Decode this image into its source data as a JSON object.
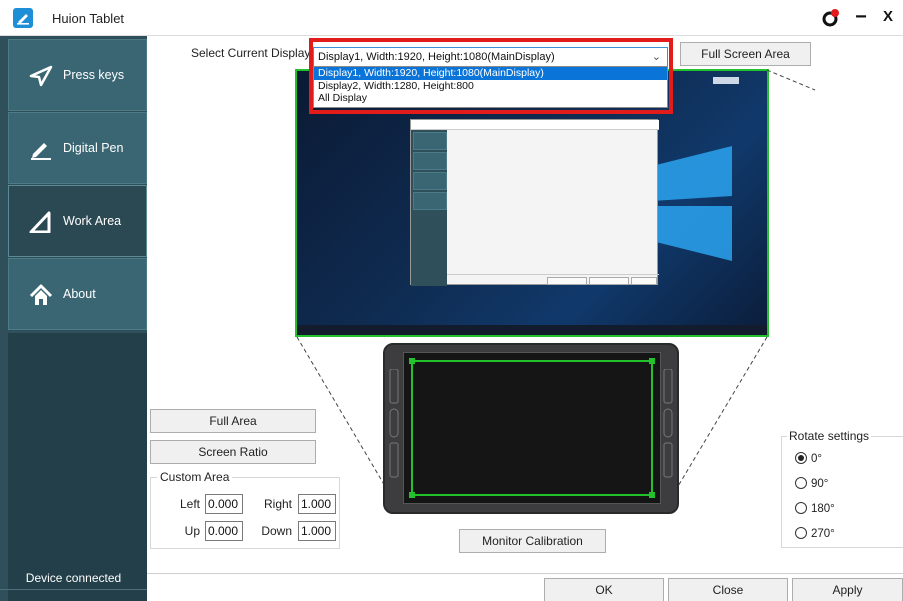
{
  "window": {
    "title": "Huion Tablet",
    "controls": {
      "minimize": "−",
      "close": "X"
    }
  },
  "sidebar": {
    "items": [
      {
        "label": "Press keys",
        "icon": "send-arrow-icon",
        "active": false
      },
      {
        "label": "Digital Pen",
        "icon": "pen-icon",
        "active": false
      },
      {
        "label": "Work Area",
        "icon": "work-area-icon",
        "active": true
      },
      {
        "label": "About",
        "icon": "home-icon",
        "active": false
      }
    ],
    "status": "Device connected"
  },
  "display": {
    "label": "Select Current Display",
    "selected": "Display1, Width:1920, Height:1080(MainDisplay)",
    "options": [
      "Display1, Width:1920, Height:1080(MainDisplay)",
      "Display2, Width:1280, Height:800",
      "All Display"
    ],
    "full_screen_button": "Full Screen Area"
  },
  "area": {
    "full_area_button": "Full Area",
    "screen_ratio_button": "Screen Ratio",
    "custom_area_label": "Custom Area",
    "left_label": "Left",
    "left_value": "0.000",
    "right_label": "Right",
    "right_value": "1.000",
    "up_label": "Up",
    "up_value": "0.000",
    "down_label": "Down",
    "down_value": "1.000"
  },
  "rotate": {
    "label": "Rotate settings",
    "options": [
      "0°",
      "90°",
      "180°",
      "270°"
    ],
    "selected": "0°"
  },
  "calibration_button": "Monitor Calibration",
  "footer": {
    "ok": "OK",
    "close": "Close",
    "apply": "Apply"
  },
  "colors": {
    "sidebar": "#2f4f5b",
    "nav_item": "#3a6674",
    "active_area": "#22c22c",
    "highlight": "#e21b1b",
    "dropdown_selected": "#0a74d9"
  }
}
